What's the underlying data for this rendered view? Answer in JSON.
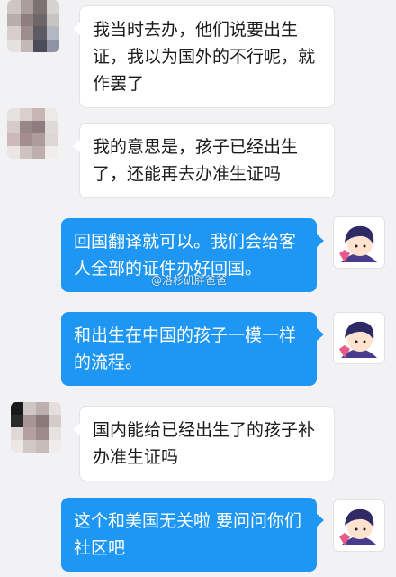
{
  "messages": [
    {
      "side": "left",
      "text": "我当时去办，他们说要出生证，我以为国外的不行呢，就作罢了"
    },
    {
      "side": "left",
      "text": "我的意思是，孩子已经出生了，还能再去办准生证吗"
    },
    {
      "side": "right",
      "text": "回国翻译就可以。我们会给客人全部的证件办好回国。"
    },
    {
      "side": "right",
      "text": "和出生在中国的孩子一模一样的流程。"
    },
    {
      "side": "left",
      "text": "国内能给已经出生了的孩子补办准生证吗"
    },
    {
      "side": "right",
      "text": "这个和美国无关啦 要问问你们社区吧"
    }
  ],
  "watermark": "@洛杉矶胖爸爸",
  "colors": {
    "outgoing_bubble": "#1e96f3",
    "incoming_bubble": "#ffffff",
    "background": "#f2f2f4"
  },
  "avatars": {
    "contact": "pixelated-avatar",
    "self": "cartoon-boy-avatar"
  }
}
